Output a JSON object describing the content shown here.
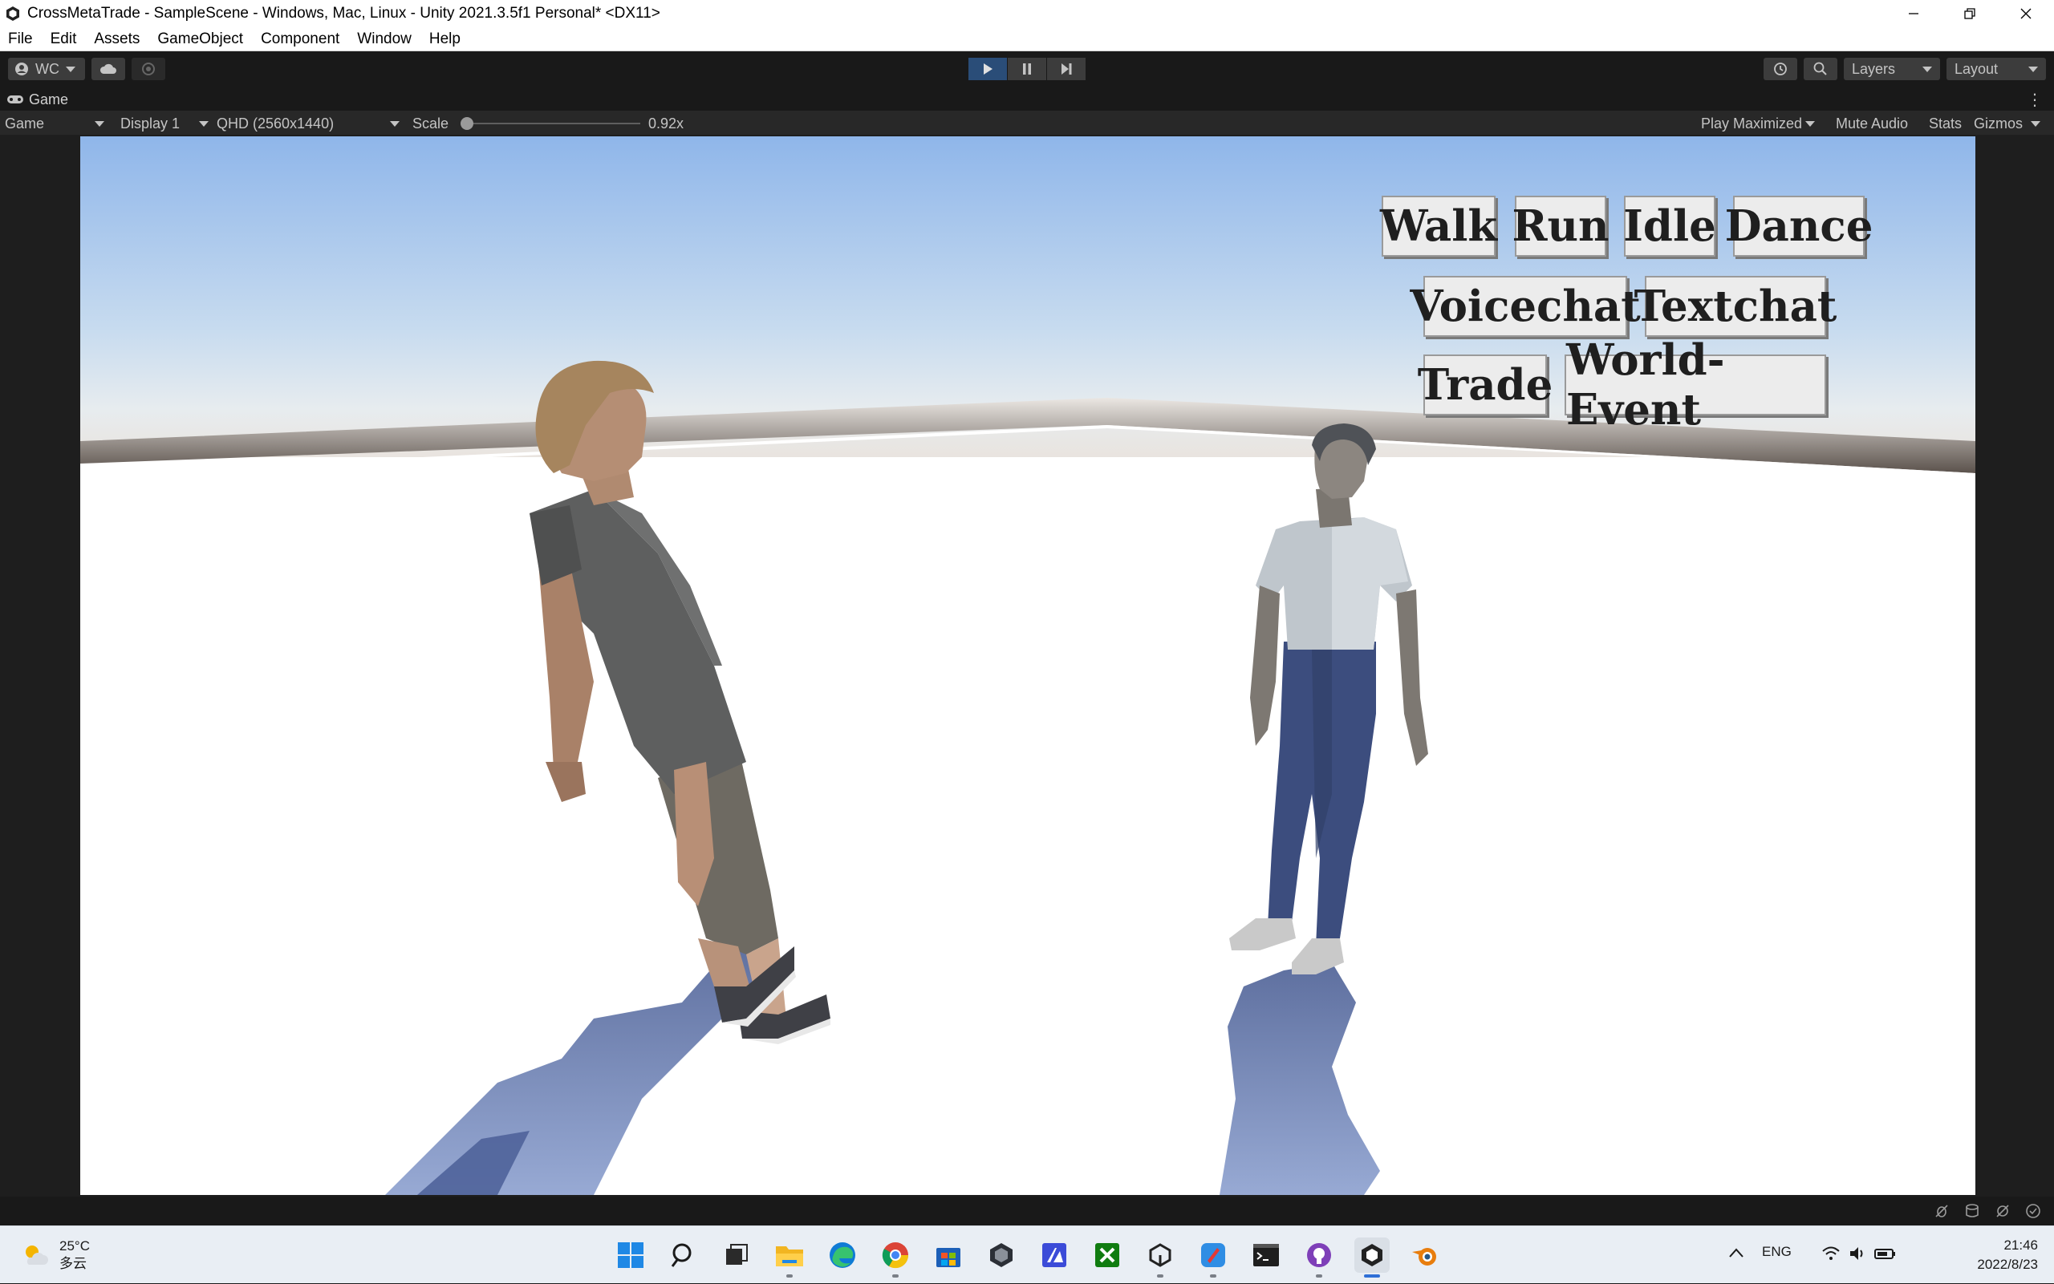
{
  "window": {
    "title": "CrossMetaTrade - SampleScene - Windows, Mac, Linux - Unity 2021.3.5f1 Personal* <DX11>"
  },
  "menu": [
    "File",
    "Edit",
    "Assets",
    "GameObject",
    "Component",
    "Window",
    "Help"
  ],
  "toolbar": {
    "account_label": "WC",
    "layers_label": "Layers",
    "layout_label": "Layout"
  },
  "tab": {
    "label": "Game"
  },
  "game_toolbar": {
    "mode": "Game",
    "display": "Display 1",
    "resolution": "QHD (2560x1440)",
    "scale_label": "Scale",
    "scale_value": "0.92x",
    "scale_fraction": 0.02,
    "play_maximized": "Play Maximized",
    "mute_audio": "Mute Audio",
    "stats": "Stats",
    "gizmos": "Gizmos"
  },
  "game_ui": {
    "buttons": [
      "Walk",
      "Run",
      "Idle",
      "Dance",
      "Voicechat",
      "Textchat",
      "Trade",
      "World-Event"
    ]
  },
  "colors": {
    "editor_bg": "#191919",
    "sky_top": "#8fb6ea",
    "ground": "#ffffff",
    "play_active": "#2a4d78",
    "button_bg": "#ececec"
  },
  "taskbar": {
    "weather_temp": "25°C",
    "weather_desc": "多云",
    "icons": [
      "windows-start-icon",
      "search-icon",
      "task-view-icon",
      "file-explorer-icon",
      "edge-icon",
      "chrome-icon",
      "store-icon",
      "unity-hub-icon",
      "visual-studio-icon",
      "xbox-icon",
      "unity-icon",
      "app-icon",
      "terminal-icon",
      "github-icon",
      "unity-editor-icon",
      "blender-icon"
    ],
    "language": "ENG",
    "time": "21:46",
    "date": "2022/8/23"
  }
}
